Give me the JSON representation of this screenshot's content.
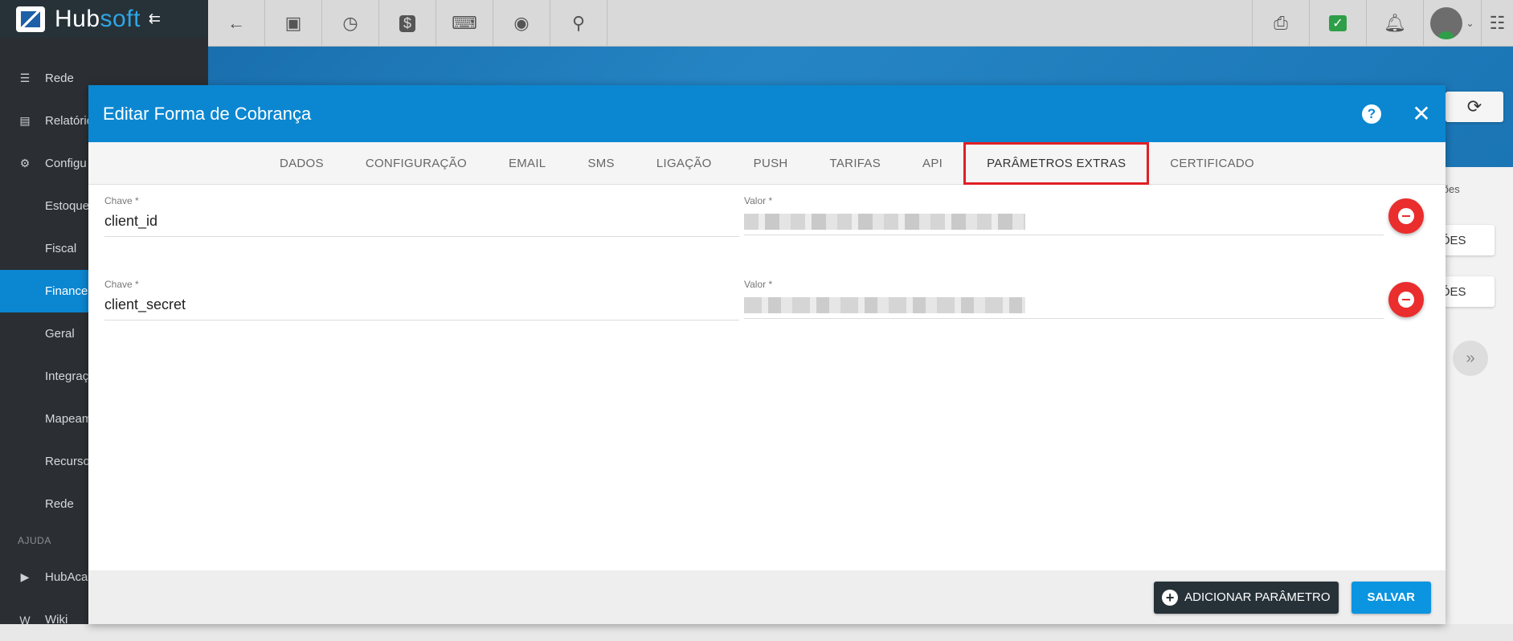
{
  "app": {
    "logo_hub": "Hub",
    "logo_soft": "soft"
  },
  "sidebar": {
    "items": [
      {
        "label": "Rede",
        "icon": "server-icon"
      },
      {
        "label": "Relatório",
        "icon": "document-icon"
      },
      {
        "label": "Configu",
        "icon": "gear-icon"
      }
    ],
    "sub_items": [
      {
        "label": "Estoque"
      },
      {
        "label": "Fiscal"
      },
      {
        "label": "Financei",
        "active": true
      },
      {
        "label": "Geral"
      },
      {
        "label": "Integraçõ"
      },
      {
        "label": "Mapeam"
      },
      {
        "label": "Recursos"
      },
      {
        "label": "Rede"
      }
    ],
    "section_help": "AJUDA",
    "help_items": [
      {
        "label": "HubAcad",
        "icon": "youtube-icon"
      },
      {
        "label": "Wiki",
        "icon": "wikipedia-icon"
      }
    ]
  },
  "topbar": {
    "left_icons": [
      "back-arrow-icon",
      "contact-icon",
      "calendar-clock-icon",
      "dollar-icon",
      "terminal-icon",
      "eye-icon",
      "search-icon"
    ],
    "right_icons": [
      "pdf-icon",
      "chat-check-icon",
      "bell-icon"
    ]
  },
  "background": {
    "partial_text_1": "ações",
    "btn_1": "ÇÕES",
    "btn_2": "ÇÕES"
  },
  "modal": {
    "title": "Editar Forma de Cobrança",
    "tabs": [
      "DADOS",
      "CONFIGURAÇÃO",
      "EMAIL",
      "SMS",
      "LIGAÇÃO",
      "PUSH",
      "TARIFAS",
      "API",
      "PARÂMETROS EXTRAS",
      "CERTIFICADO"
    ],
    "active_tab": "PARÂMETROS EXTRAS",
    "params": [
      {
        "key_label": "Chave *",
        "key_value": "client_id",
        "value_label": "Valor *"
      },
      {
        "key_label": "Chave *",
        "key_value": "client_secret",
        "value_label": "Valor *"
      }
    ],
    "footer": {
      "add_label": "ADICIONAR PARÂMETRO",
      "save_label": "SALVAR"
    }
  },
  "colors": {
    "accent": "#0b87d1",
    "highlight": "#e01f26",
    "remove": "#ea2d2d",
    "dark": "#263238"
  }
}
